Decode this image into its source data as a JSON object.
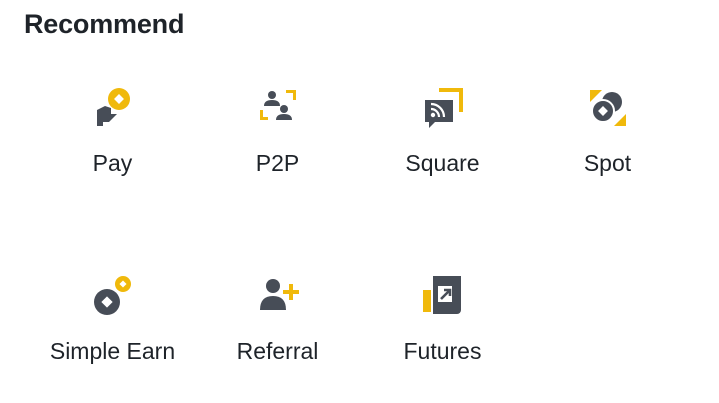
{
  "section": {
    "title": "Recommend"
  },
  "colors": {
    "dark": "#474d57",
    "accent": "#f0b90b",
    "text": "#1e2329"
  },
  "tiles": [
    {
      "label": "Pay",
      "icon": "pay-icon"
    },
    {
      "label": "P2P",
      "icon": "p2p-icon"
    },
    {
      "label": "Square",
      "icon": "square-icon"
    },
    {
      "label": "Spot",
      "icon": "spot-icon"
    },
    {
      "label": "Simple Earn",
      "icon": "simple-earn-icon"
    },
    {
      "label": "Referral",
      "icon": "referral-icon"
    },
    {
      "label": "Futures",
      "icon": "futures-icon"
    }
  ]
}
